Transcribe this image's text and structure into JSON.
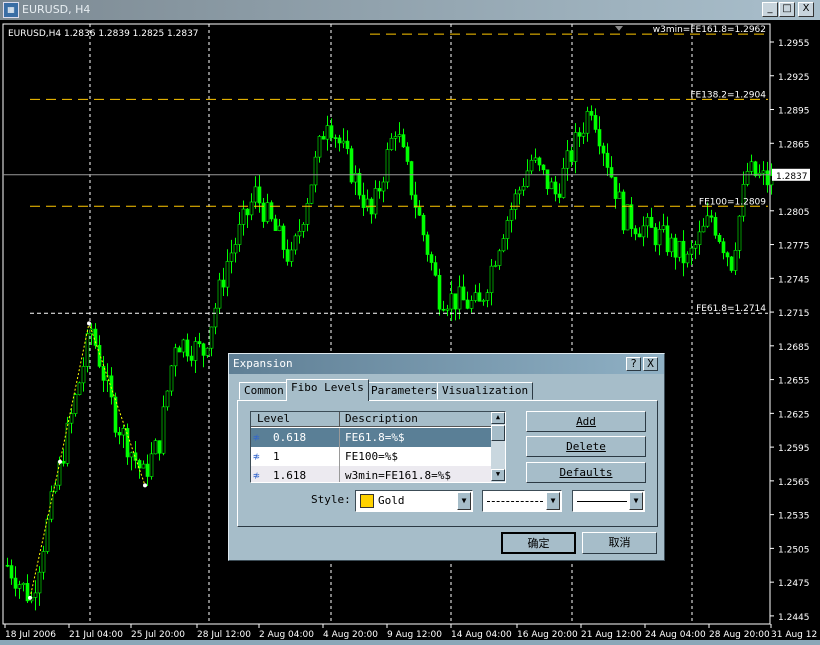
{
  "window": {
    "title": "EURUSD, H4",
    "icon": "chart-window-icon",
    "buttons": [
      "_",
      "□",
      "X"
    ]
  },
  "chart": {
    "info": "EURUSD,H4  1.2836  1.2839  1.2825  1.2837",
    "colors": {
      "background": "#000000",
      "bull": "#00ff00",
      "bear": "#00ff00",
      "fibo": "#ffc800",
      "grid": "#ffffff",
      "zigzag": "#ffff00"
    },
    "price_axis": [
      "1.2955",
      "1.2925",
      "1.2895",
      "1.2865",
      "1.2805",
      "1.2775",
      "1.2745",
      "1.2715",
      "1.2685",
      "1.2655",
      "1.2625",
      "1.2595",
      "1.2565",
      "1.2535",
      "1.2505",
      "1.2475",
      "1.2445"
    ],
    "price_range": [
      1.2445,
      1.2955
    ],
    "current_price": "1.2837",
    "time_axis": [
      "18 Jul 2006",
      "21 Jul 04:00",
      "25 Jul 20:00",
      "28 Jul 12:00",
      "2 Aug 04:00",
      "4 Aug 20:00",
      "9 Aug 12:00",
      "14 Aug 04:00",
      "16 Aug 20:00",
      "21 Aug 12:00",
      "24 Aug 04:00",
      "28 Aug 20:00",
      "31 Aug 12"
    ],
    "fibo_levels": [
      {
        "price": 1.2962,
        "label": "w3min=FE161.8=1.2962"
      },
      {
        "price": 1.2904,
        "label": "FE138.2=1.2904"
      },
      {
        "price": 1.2809,
        "label": "FE100=1.2809"
      },
      {
        "price": 1.2714,
        "label": "FE61.8=1.2714"
      }
    ],
    "zigzag": [
      1.2461,
      1.2582,
      1.2705,
      1.2561
    ],
    "close_path": [
      [
        0,
        1.249
      ],
      [
        6,
        1.246
      ],
      [
        12,
        1.256
      ],
      [
        21,
        1.27
      ],
      [
        27,
        1.262
      ],
      [
        34,
        1.257
      ],
      [
        38,
        1.26
      ],
      [
        42,
        1.269
      ],
      [
        49,
        1.268
      ],
      [
        55,
        1.276
      ],
      [
        62,
        1.282
      ],
      [
        71,
        1.276
      ],
      [
        80,
        1.289
      ],
      [
        91,
        1.28
      ],
      [
        97,
        1.288
      ],
      [
        108,
        1.273
      ],
      [
        118,
        1.272
      ],
      [
        124,
        1.279
      ],
      [
        131,
        1.285
      ],
      [
        137,
        1.282
      ],
      [
        146,
        1.29
      ],
      [
        154,
        1.28
      ],
      [
        164,
        1.278
      ],
      [
        170,
        1.276
      ],
      [
        176,
        1.28
      ],
      [
        181,
        1.276
      ],
      [
        185,
        1.284
      ],
      [
        191,
        1.283
      ]
    ]
  },
  "dialog": {
    "title": "Expansion",
    "help": "?",
    "close": "X",
    "tabs": [
      "Common",
      "Fibo Levels",
      "Parameters",
      "Visualization"
    ],
    "active_tab": "Fibo Levels",
    "columns": [
      "Level",
      "Description"
    ],
    "rows": [
      {
        "level": "0.618",
        "description": "FE61.8=%$",
        "selected": true
      },
      {
        "level": "1",
        "description": "FE100=%$"
      },
      {
        "level": "1.618",
        "description": "w3min=FE161.8=%$"
      }
    ],
    "buttons": {
      "add": "Add",
      "delete": "Delete",
      "defaults": "Defaults",
      "ok": "确定",
      "cancel": "取消"
    },
    "style_label": "Style:",
    "color_value": "Gold",
    "color_hex": "#ffd200",
    "line_style": "dashed",
    "line_width": "solid"
  }
}
